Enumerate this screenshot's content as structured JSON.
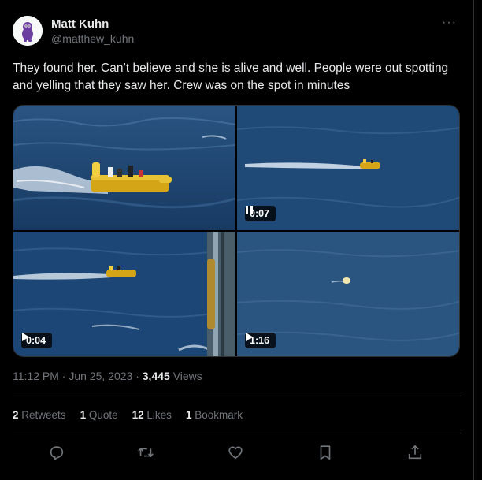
{
  "author": {
    "name": "Matt Kuhn",
    "handle": "@matthew_kuhn",
    "avatar_icon": "cartoon-character-avatar"
  },
  "more_icon": "more-horizontal-icon",
  "more_glyph": "···",
  "tweet_text": "They found her. Can’t believe and she is alive and well. People were out spotting and yelling that they saw her. Crew was on the spot in minutes",
  "media": {
    "items": [
      {
        "kind": "photo",
        "duration": ""
      },
      {
        "kind": "video",
        "state": "playing",
        "duration": "0:07",
        "control_icon": "pause-icon"
      },
      {
        "kind": "video",
        "state": "paused",
        "duration": "0:04",
        "control_icon": "play-icon"
      },
      {
        "kind": "video",
        "state": "paused",
        "duration": "1:16",
        "control_icon": "play-icon"
      }
    ]
  },
  "meta": {
    "time": "11:12 PM",
    "separator": "·",
    "date": "Jun 25, 2023",
    "views_count": "3,445",
    "views_label": "Views"
  },
  "stats": {
    "retweets_count": "2",
    "retweets_label": "Retweets",
    "quotes_count": "1",
    "quotes_label": "Quote",
    "likes_count": "12",
    "likes_label": "Likes",
    "bookmarks_count": "1",
    "bookmarks_label": "Bookmark"
  },
  "actions": [
    {
      "name": "reply",
      "icon": "reply-icon"
    },
    {
      "name": "retweet",
      "icon": "retweet-icon"
    },
    {
      "name": "like",
      "icon": "heart-icon"
    },
    {
      "name": "bookmark",
      "icon": "bookmark-icon"
    },
    {
      "name": "share",
      "icon": "share-icon"
    }
  ],
  "colors": {
    "background": "#000000",
    "text_primary": "#e7e9ea",
    "text_secondary": "#71767b",
    "divider": "#2f3336",
    "sea": "#1f4a78",
    "boat": "#e2b21a"
  }
}
